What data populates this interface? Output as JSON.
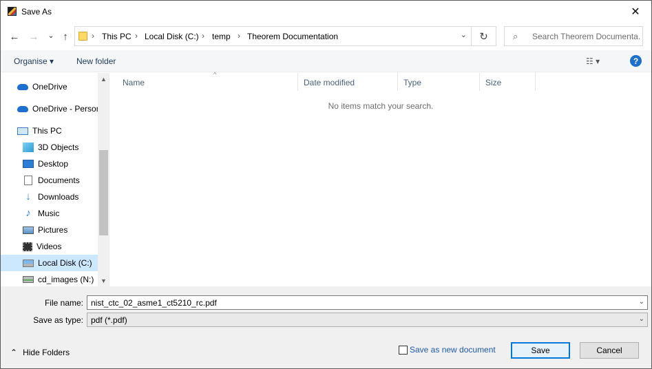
{
  "window": {
    "title": "Save As",
    "close_glyph": "✕"
  },
  "nav": {
    "back_glyph": "←",
    "forward_glyph": "→",
    "recent_glyph": "⌄",
    "up_glyph": "↑",
    "breadcrumbs": [
      "This PC",
      "Local Disk (C:)",
      "temp",
      "Theorem Documentation"
    ],
    "separator": "›",
    "dropdown_glyph": "⌄",
    "refresh_glyph": "↻",
    "search_placeholder": "Search Theorem Documenta...",
    "search_glyph": "⌕"
  },
  "toolbar": {
    "organise": "Organise ▾",
    "new_folder": "New folder",
    "view_glyph": "☷ ▾",
    "help_glyph": "?"
  },
  "sidebar": {
    "items": [
      {
        "label": "OneDrive",
        "icon": "onedrive-icon"
      },
      {
        "label": "OneDrive - Personal",
        "icon": "onedrive-icon"
      },
      {
        "label": "This PC",
        "icon": "computer-icon"
      },
      {
        "label": "3D Objects",
        "icon": "3d-objects-icon"
      },
      {
        "label": "Desktop",
        "icon": "desktop-icon"
      },
      {
        "label": "Documents",
        "icon": "documents-icon"
      },
      {
        "label": "Downloads",
        "icon": "downloads-icon"
      },
      {
        "label": "Music",
        "icon": "music-icon"
      },
      {
        "label": "Pictures",
        "icon": "pictures-icon"
      },
      {
        "label": "Videos",
        "icon": "videos-icon"
      },
      {
        "label": "Local Disk (C:)",
        "icon": "local-disk-icon",
        "selected": true
      },
      {
        "label": "cd_images (N:)",
        "icon": "network-drive-icon"
      }
    ],
    "scroll_up_glyph": "▲",
    "scroll_down_glyph": "▼"
  },
  "filelist": {
    "columns": [
      "Name",
      "Date modified",
      "Type",
      "Size"
    ],
    "sort_glyph": "^",
    "empty_message": "No items match your search."
  },
  "form": {
    "file_name_label": "File name:",
    "file_name_value": "nist_ctc_02_asme1_ct5210_rc.pdf",
    "save_type_label": "Save as type:",
    "save_type_value": "pdf (*.pdf)",
    "dropdown_glyph": "⌄",
    "hide_folders": "Hide Folders",
    "hide_folders_glyph": "⌃",
    "save_new_doc_label": "Save as new document",
    "save_label": "Save",
    "cancel_label": "Cancel"
  }
}
